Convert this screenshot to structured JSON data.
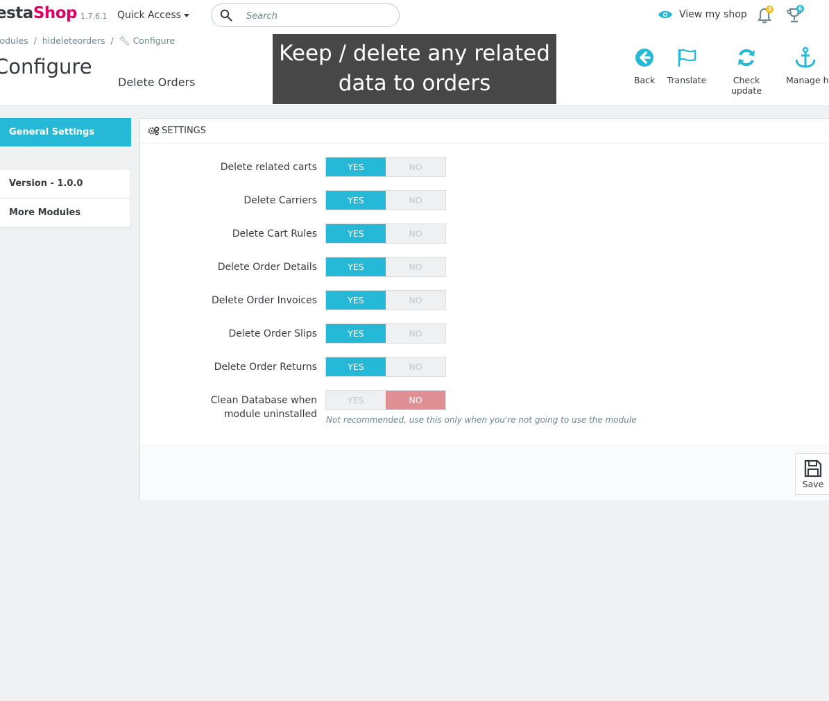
{
  "header": {
    "logo_part1": "esta",
    "logo_part2": "Shop",
    "version": "1.7.6.1",
    "quick_access": "Quick Access",
    "search_placeholder": "Search",
    "view_shop": "View my shop",
    "notifications_count": "3",
    "trophy_count": "6"
  },
  "breadcrumb": [
    "lodules",
    "hideleteorders",
    "Configure"
  ],
  "page_title": "Configure",
  "subtitle": "Delete Orders",
  "overlay_caption": "Keep / delete any related data to orders",
  "toolbar": [
    {
      "label": "Back",
      "icon": "arrow-left-circle-icon"
    },
    {
      "label": "Translate",
      "icon": "flag-icon"
    },
    {
      "label": "Check update",
      "icon": "refresh-icon"
    },
    {
      "label": "Manage h",
      "icon": "anchor-icon"
    }
  ],
  "sidebar": {
    "active": "General Settings",
    "items": [
      "Version - 1.0.0",
      "More Modules"
    ]
  },
  "panel": {
    "title": "SETTINGS",
    "yes_label": "YES",
    "no_label": "NO",
    "rows": [
      {
        "label": "Delete related carts",
        "value": "yes"
      },
      {
        "label": "Delete Carriers",
        "value": "yes"
      },
      {
        "label": "Delete Cart Rules",
        "value": "yes"
      },
      {
        "label": "Delete Order Details",
        "value": "yes"
      },
      {
        "label": "Delete Order Invoices",
        "value": "yes"
      },
      {
        "label": "Delete Order Slips",
        "value": "yes"
      },
      {
        "label": "Delete Order Returns",
        "value": "yes"
      },
      {
        "label": "Clean Database when module uninstalled",
        "value": "no"
      }
    ],
    "help_text": "Not recommended, use this only when you're not going to use the module",
    "save_label": "Save"
  },
  "colors": {
    "accent": "#25b9d7",
    "brand": "#df0067",
    "danger": "#e08f95"
  }
}
